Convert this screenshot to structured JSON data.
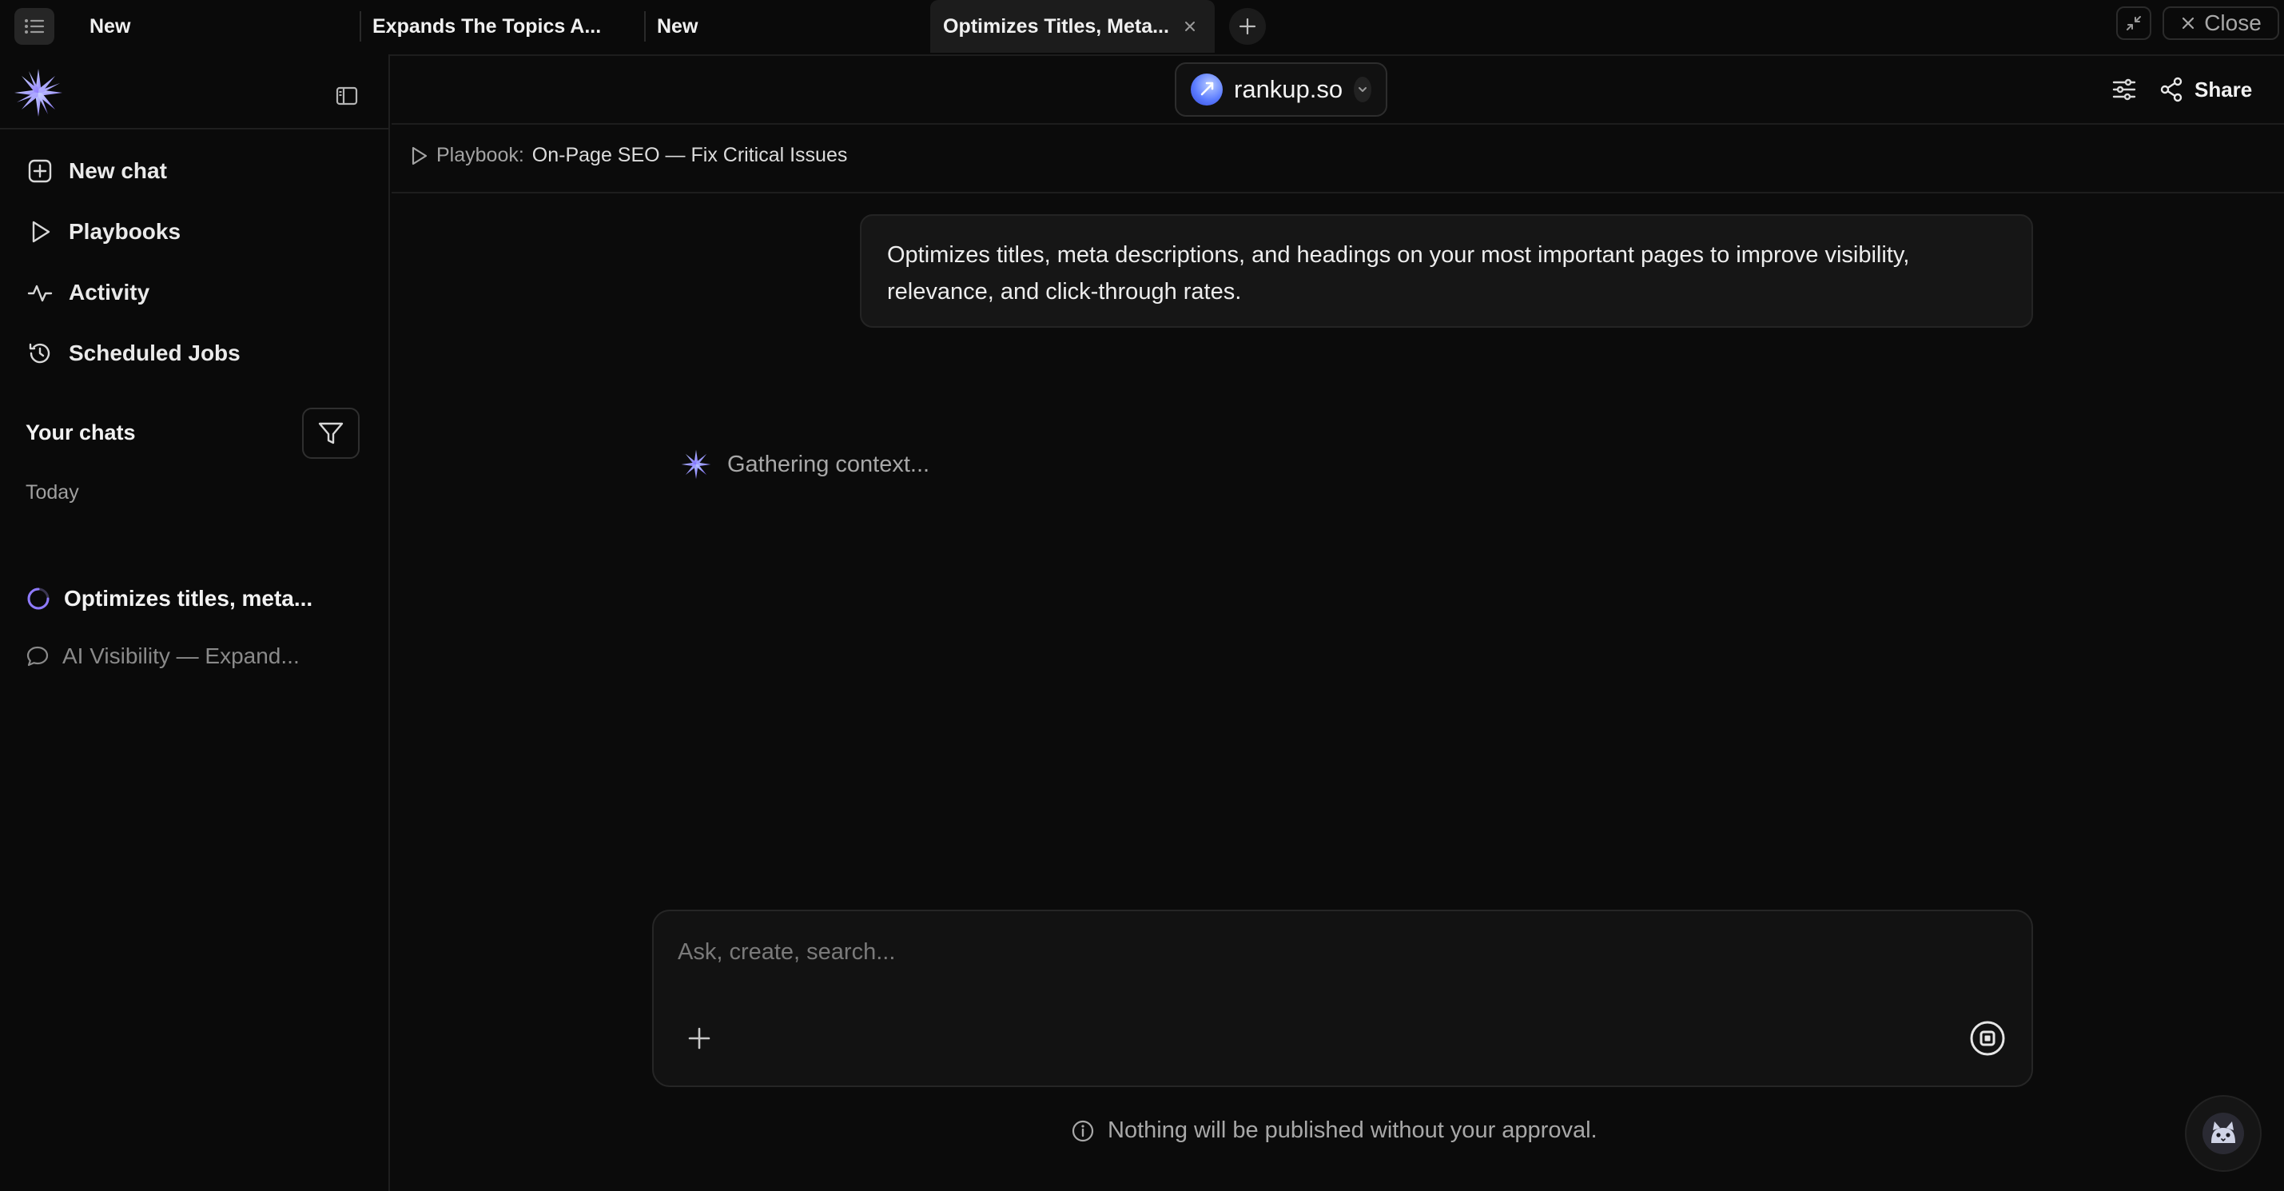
{
  "tabs": [
    {
      "label": "New",
      "active": false
    },
    {
      "label": "Expands The Topics A...",
      "active": false
    },
    {
      "label": "New",
      "active": false
    },
    {
      "label": "Optimizes Titles, Meta...",
      "active": true
    }
  ],
  "window": {
    "close_label": "Close"
  },
  "sidebar": {
    "nav": [
      {
        "label": "New chat",
        "icon": "plus-square-icon"
      },
      {
        "label": "Playbooks",
        "icon": "play-icon"
      },
      {
        "label": "Activity",
        "icon": "activity-icon"
      },
      {
        "label": "Scheduled Jobs",
        "icon": "history-icon"
      }
    ],
    "chats_title": "Your chats",
    "group_label": "Today",
    "chats": [
      {
        "label": "Optimizes titles, meta...",
        "state": "running"
      },
      {
        "label": "AI Visibility — Expand...",
        "state": "idle"
      }
    ]
  },
  "header": {
    "workspace": "rankup.so",
    "share_label": "Share"
  },
  "breadcrumb": {
    "prefix": "Playbook:",
    "name": "On-Page SEO — Fix Critical Issues"
  },
  "conversation": {
    "prompt": "Optimizes titles, meta descriptions, and headings on your most important pages to improve visibility, relevance, and click-through rates.",
    "status": "Gathering context..."
  },
  "composer": {
    "placeholder": "Ask, create, search..."
  },
  "disclaimer": "Nothing will be published without your approval.",
  "colors": {
    "background": "#0b0b0b",
    "accent_purple": "#8f7bff",
    "accent_blue": "#5b7cff"
  }
}
